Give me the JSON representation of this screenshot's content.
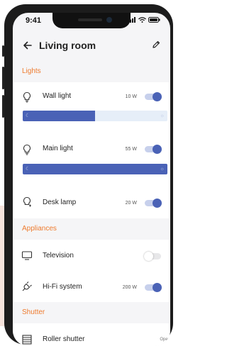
{
  "status_bar": {
    "time": "9:41"
  },
  "header": {
    "title": "Living room",
    "back_icon": "arrow-left-icon",
    "edit_icon": "pencil-icon"
  },
  "sections": {
    "lights": {
      "title": "Lights",
      "items": [
        {
          "label": "Wall light",
          "value": "10 W",
          "on": true,
          "brightness_fraction": 0.5,
          "icon": "lightbulb-icon"
        },
        {
          "label": "Main light",
          "value": "55 W",
          "on": true,
          "brightness_fraction": 1.0,
          "icon": "lightbulb-icon"
        },
        {
          "label": "Desk lamp",
          "value": "20 W",
          "on": true,
          "icon": "desk-lamp-icon"
        }
      ]
    },
    "appliances": {
      "title": "Appliances",
      "items": [
        {
          "label": "Television",
          "value": "",
          "on": false,
          "icon": "tv-icon"
        },
        {
          "label": "Hi-Fi system",
          "value": "200 W",
          "on": true,
          "icon": "plug-icon"
        }
      ]
    },
    "shutter": {
      "title": "Shutter",
      "items": [
        {
          "label": "Roller shutter",
          "status": "Open",
          "icon": "shutter-icon"
        }
      ]
    }
  },
  "colors": {
    "accent": "#4a62b6",
    "section_title": "#ee7b2f",
    "track": "#e6eef8"
  }
}
